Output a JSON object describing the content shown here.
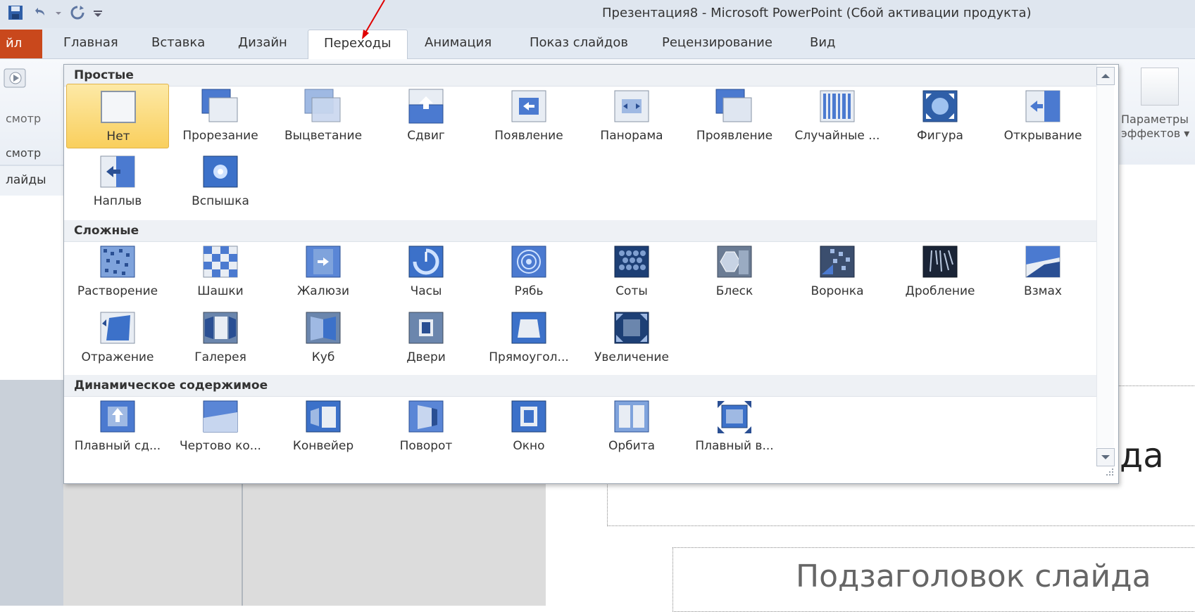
{
  "window": {
    "title": "Презентация8  -  Microsoft PowerPoint (Сбой активации продукта)"
  },
  "tabs": {
    "file": "йл",
    "items": [
      "Главная",
      "Вставка",
      "Дизайн",
      "Переходы",
      "Анимация",
      "Показ слайдов",
      "Рецензирование",
      "Вид"
    ],
    "active": "Переходы"
  },
  "ribbon": {
    "left_labels": [
      "смотр",
      "смотр"
    ],
    "slides_tab": "лайды",
    "effects_label_line1": "Параметры",
    "effects_label_line2": "эффектов ▾"
  },
  "gallery": {
    "sections": [
      {
        "title": "Простые",
        "items": [
          "Нет",
          "Прорезание",
          "Выцветание",
          "Сдвиг",
          "Появление",
          "Панорама",
          "Проявление",
          "Случайные ...",
          "Фигура",
          "Открывание",
          "Наплыв",
          "Вспышка"
        ],
        "selected": "Нет"
      },
      {
        "title": "Сложные",
        "items": [
          "Растворение",
          "Шашки",
          "Жалюзи",
          "Часы",
          "Рябь",
          "Соты",
          "Блеск",
          "Воронка",
          "Дробление",
          "Взмах",
          "Отражение",
          "Галерея",
          "Куб",
          "Двери",
          "Прямоугол...",
          "Увеличение"
        ]
      },
      {
        "title": "Динамическое содержимое",
        "items": [
          "Плавный сд...",
          "Чертово ко...",
          "Конвейер",
          "Поворот",
          "Окно",
          "Орбита",
          "Плавный в..."
        ]
      }
    ]
  },
  "slide": {
    "title_fragment": "да",
    "subtitle": "Подзаголовок слайда"
  },
  "colors": {
    "file_tab": "#c9481c",
    "selection": "#f9cf5d",
    "annotation_arrow": "#e00000"
  }
}
